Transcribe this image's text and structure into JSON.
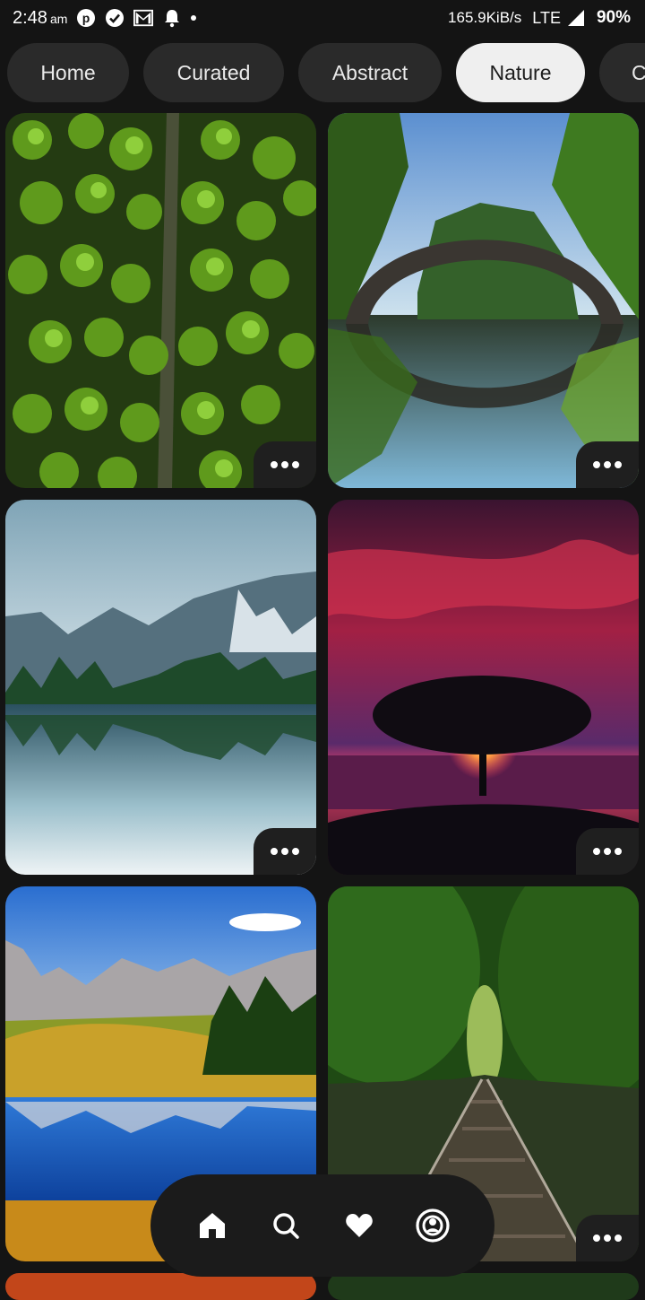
{
  "status_bar": {
    "time": "2:48",
    "ampm": "am",
    "network_speed": "165.9KiB/s",
    "network_type": "LTE",
    "battery": "90%",
    "icons": [
      "pinterest-icon",
      "check-circle-icon",
      "gmail-icon",
      "notification-bell-icon",
      "dot-icon"
    ]
  },
  "tabs": [
    {
      "label": "Home",
      "active": false
    },
    {
      "label": "Curated",
      "active": false
    },
    {
      "label": "Abstract",
      "active": false
    },
    {
      "label": "Nature",
      "active": true
    },
    {
      "label": "C",
      "active": false
    }
  ],
  "wallpapers": [
    {
      "subject": "aerial-forest",
      "more_icon": "more-dots-icon"
    },
    {
      "subject": "arch-bridge-reflection",
      "more_icon": "more-dots-icon"
    },
    {
      "subject": "mountain-lake-reflection",
      "more_icon": "more-dots-icon"
    },
    {
      "subject": "tree-sunset-red-sky",
      "more_icon": "more-dots-icon"
    },
    {
      "subject": "alpine-meadow-lake",
      "more_icon": "more-dots-icon"
    },
    {
      "subject": "railway-forest",
      "more_icon": "more-dots-icon"
    }
  ],
  "bottom_nav": {
    "items": [
      "home-icon",
      "search-icon",
      "heart-icon",
      "profile-icon"
    ]
  },
  "colors": {
    "background": "#141414",
    "tab_bg": "#2a2a2a",
    "tab_active_bg": "#efefef",
    "nav_bg": "#1b1b1b"
  }
}
